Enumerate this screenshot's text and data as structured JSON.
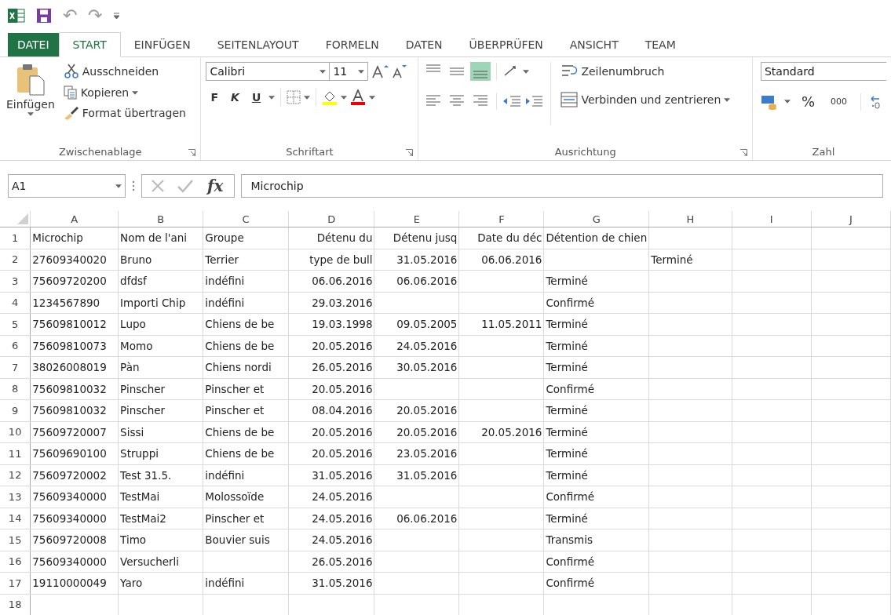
{
  "quick_access": {
    "undo": "↶",
    "redo": "↷"
  },
  "tabs": [
    {
      "label": "DATEI",
      "kind": "file",
      "selected": false
    },
    {
      "label": "START",
      "kind": "tab",
      "selected": true
    },
    {
      "label": "EINFÜGEN",
      "kind": "tab",
      "selected": false
    },
    {
      "label": "SEITENLAYOUT",
      "kind": "tab",
      "selected": false
    },
    {
      "label": "FORMELN",
      "kind": "tab",
      "selected": false
    },
    {
      "label": "DATEN",
      "kind": "tab",
      "selected": false
    },
    {
      "label": "ÜBERPRÜFEN",
      "kind": "tab",
      "selected": false
    },
    {
      "label": "ANSICHT",
      "kind": "tab",
      "selected": false
    },
    {
      "label": "TEAM",
      "kind": "tab",
      "selected": false
    }
  ],
  "clipboard": {
    "paste": "Einfügen",
    "cut": "Ausschneiden",
    "copy": "Kopieren",
    "format_painter": "Format übertragen",
    "group": "Zwischenablage"
  },
  "font": {
    "name": "Calibri",
    "size": "11",
    "bold": "F",
    "italic": "K",
    "underline": "U",
    "group": "Schriftart"
  },
  "alignment": {
    "wrap": "Zeilenumbruch",
    "merge": "Verbinden und zentrieren",
    "group": "Ausrichtung"
  },
  "number": {
    "format": "Standard",
    "percent": "%",
    "thousands": "000",
    "group": "Zahl"
  },
  "formula_bar": {
    "name_box": "A1",
    "fx": "fx",
    "value": "Microchip"
  },
  "sheet": {
    "columns": [
      "A",
      "B",
      "C",
      "D",
      "E",
      "F",
      "G",
      "H",
      "I",
      "J"
    ],
    "rows": [
      {
        "n": "1",
        "A": "Microchip",
        "B": "Nom de l'ani",
        "C": "Groupe",
        "D": "Détenu du",
        "E": "Détenu jusq",
        "F": "Date du déc",
        "G": "Détention de chien"
      },
      {
        "n": "2",
        "A": "27609340020",
        "B": "Bruno",
        "C": "Terrier",
        "D": "type de bull",
        "E": "31.05.2016",
        "F": "06.06.2016",
        "H": "Terminé"
      },
      {
        "n": "3",
        "A": "75609720200",
        "B": "dfdsf",
        "C": "indéfini",
        "D": "06.06.2016",
        "E": "06.06.2016",
        "G": "Terminé"
      },
      {
        "n": "4",
        "A": "1234567890",
        "B": "Importi Chip",
        "C": "indéfini",
        "D": "29.03.2016",
        "G": "Confirmé"
      },
      {
        "n": "5",
        "A": "75609810012",
        "B": "Lupo",
        "C": "Chiens de be",
        "D": "19.03.1998",
        "E": "09.05.2005",
        "F": "11.05.2011",
        "G": "Terminé"
      },
      {
        "n": "6",
        "A": "75609810073",
        "B": "Momo",
        "C": "Chiens de be",
        "D": "20.05.2016",
        "E": "24.05.2016",
        "G": "Terminé"
      },
      {
        "n": "7",
        "A": "38026008019",
        "B": "Pàn",
        "C": "Chiens nordi",
        "D": "26.05.2016",
        "E": "30.05.2016",
        "G": "Terminé"
      },
      {
        "n": "8",
        "A": "75609810032",
        "B": "Pinscher",
        "C": "Pinscher et",
        "D": "20.05.2016",
        "G": "Confirmé"
      },
      {
        "n": "9",
        "A": "75609810032",
        "B": "Pinscher",
        "C": "Pinscher et",
        "D": "08.04.2016",
        "E": "20.05.2016",
        "G": "Terminé"
      },
      {
        "n": "10",
        "A": "75609720007",
        "B": "Sissi",
        "C": "Chiens de be",
        "D": "20.05.2016",
        "E": "20.05.2016",
        "F": "20.05.2016",
        "G": "Terminé"
      },
      {
        "n": "11",
        "A": "75609690100",
        "B": "Struppi",
        "C": "Chiens de be",
        "D": "20.05.2016",
        "E": "23.05.2016",
        "G": "Terminé"
      },
      {
        "n": "12",
        "A": "75609720002",
        "B": "Test 31.5.",
        "C": "indéfini",
        "D": "31.05.2016",
        "E": "31.05.2016",
        "G": "Terminé"
      },
      {
        "n": "13",
        "A": "75609340000",
        "B": "TestMai",
        "C": "Molossoïde",
        "D": "24.05.2016",
        "G": "Confirmé"
      },
      {
        "n": "14",
        "A": "75609340000",
        "B": "TestMai2",
        "C": "Pinscher et",
        "D": "24.05.2016",
        "E": "06.06.2016",
        "G": "Terminé"
      },
      {
        "n": "15",
        "A": "75609720008",
        "B": "Timo",
        "C": "Bouvier suis",
        "D": "24.05.2016",
        "G": "Transmis"
      },
      {
        "n": "16",
        "A": "75609340000",
        "B": "Versucherli",
        "D": "26.05.2016",
        "G": "Confirmé"
      },
      {
        "n": "17",
        "A": "19110000049",
        "B": "Yaro",
        "C": "indéfini",
        "D": "31.05.2016",
        "G": "Confirmé"
      },
      {
        "n": "18"
      }
    ]
  }
}
